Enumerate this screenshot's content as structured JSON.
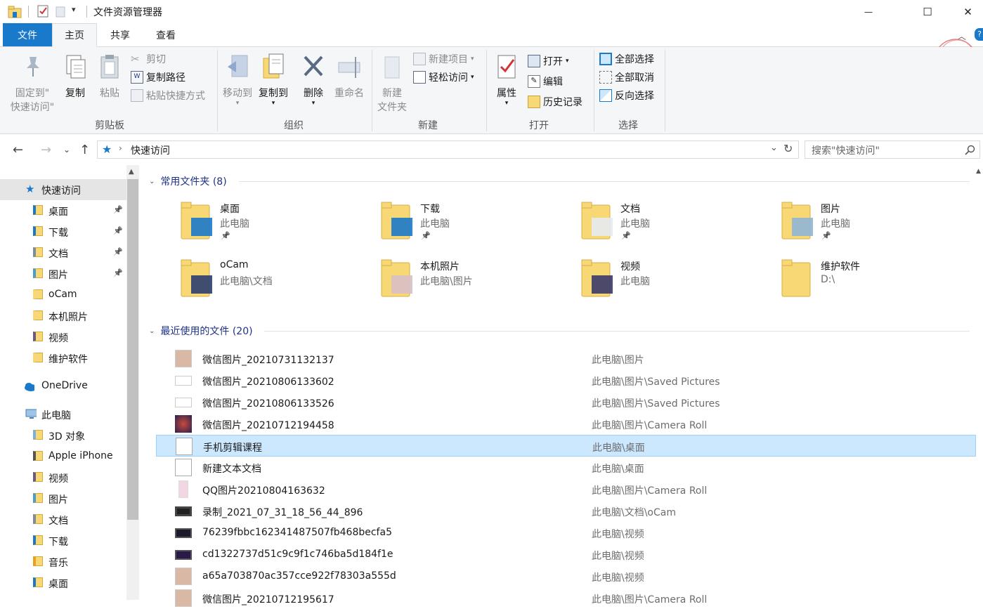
{
  "window": {
    "title": "文件资源管理器",
    "minimize": "—",
    "maximize": "☐",
    "close": "✕"
  },
  "tabs": [
    {
      "label": "文件"
    },
    {
      "label": "主页"
    },
    {
      "label": "共享"
    },
    {
      "label": "查看"
    }
  ],
  "ribbon": {
    "clipboard": {
      "label": "剪贴板",
      "pin_line1": "固定到\"",
      "pin_line2": "快速访问\"",
      "copy": "复制",
      "paste": "粘贴",
      "cut": "剪切",
      "copy_path": "复制路径",
      "paste_shortcut": "粘贴快捷方式"
    },
    "organize": {
      "label": "组织",
      "move_to": "移动到",
      "copy_to": "复制到",
      "delete": "删除",
      "rename": "重命名"
    },
    "new": {
      "label": "新建",
      "new_folder_line1": "新建",
      "new_folder_line2": "文件夹",
      "new_item": "新建项目",
      "easy_access": "轻松访问"
    },
    "open": {
      "label": "打开",
      "properties": "属性",
      "open": "打开",
      "edit": "编辑",
      "history": "历史记录"
    },
    "select": {
      "label": "选择",
      "select_all": "全部选择",
      "select_none": "全部取消",
      "invert": "反向选择"
    }
  },
  "address": {
    "path": "快速访问",
    "search_placeholder": "搜索\"快速访问\""
  },
  "nav": {
    "quick_access": "快速访问",
    "items": [
      {
        "label": "桌面",
        "pinned": true
      },
      {
        "label": "下载",
        "pinned": true
      },
      {
        "label": "文档",
        "pinned": true
      },
      {
        "label": "图片",
        "pinned": true
      },
      {
        "label": "oCam",
        "pinned": false
      },
      {
        "label": "本机照片",
        "pinned": false
      },
      {
        "label": "视频",
        "pinned": false
      },
      {
        "label": "维护软件",
        "pinned": false
      }
    ],
    "onedrive": "OneDrive",
    "this_pc": "此电脑",
    "pc_items": [
      {
        "label": "3D 对象"
      },
      {
        "label": "Apple iPhone"
      },
      {
        "label": "视频"
      },
      {
        "label": "图片"
      },
      {
        "label": "文档"
      },
      {
        "label": "下载"
      },
      {
        "label": "音乐"
      },
      {
        "label": "桌面"
      }
    ]
  },
  "frequent": {
    "header": "常用文件夹 (8)",
    "folders": [
      {
        "name": "桌面",
        "location": "此电脑",
        "pinned": true
      },
      {
        "name": "下载",
        "location": "此电脑",
        "pinned": true
      },
      {
        "name": "文档",
        "location": "此电脑",
        "pinned": true
      },
      {
        "name": "图片",
        "location": "此电脑",
        "pinned": true
      },
      {
        "name": "oCam",
        "location": "此电脑\\文档",
        "pinned": false
      },
      {
        "name": "本机照片",
        "location": "此电脑\\图片",
        "pinned": false
      },
      {
        "name": "视频",
        "location": "此电脑",
        "pinned": false
      },
      {
        "name": "维护软件",
        "location": "D:\\",
        "pinned": false
      }
    ]
  },
  "recent": {
    "header": "最近使用的文件 (20)",
    "files": [
      {
        "name": "微信图片_20210731132137",
        "path": "此电脑\\图片"
      },
      {
        "name": "微信图片_20210806133602",
        "path": "此电脑\\图片\\Saved Pictures"
      },
      {
        "name": "微信图片_20210806133526",
        "path": "此电脑\\图片\\Saved Pictures"
      },
      {
        "name": "微信图片_20210712194458",
        "path": "此电脑\\图片\\Camera Roll"
      },
      {
        "name": "手机剪辑课程",
        "path": "此电脑\\桌面",
        "selected": true
      },
      {
        "name": "新建文本文档",
        "path": "此电脑\\桌面"
      },
      {
        "name": "QQ图片20210804163632",
        "path": "此电脑\\图片\\Camera Roll"
      },
      {
        "name": "录制_2021_07_31_18_56_44_896",
        "path": "此电脑\\文档\\oCam"
      },
      {
        "name": "76239fbbc162341487507fb468becfa5",
        "path": "此电脑\\视频"
      },
      {
        "name": "cd1322737d51c9c9f1c746ba5d184f1e",
        "path": "此电脑\\视频"
      },
      {
        "name": "a65a703870ac357cce922f78303a555d",
        "path": "此电脑\\视频"
      },
      {
        "name": "微信图片_20210712195617",
        "path": "此电脑\\图片\\Camera Roll"
      }
    ]
  },
  "colors": {
    "accent": "#1979ca",
    "selection": "#cce8ff",
    "folder": "#f8d775",
    "header_text": "#1e3287"
  }
}
